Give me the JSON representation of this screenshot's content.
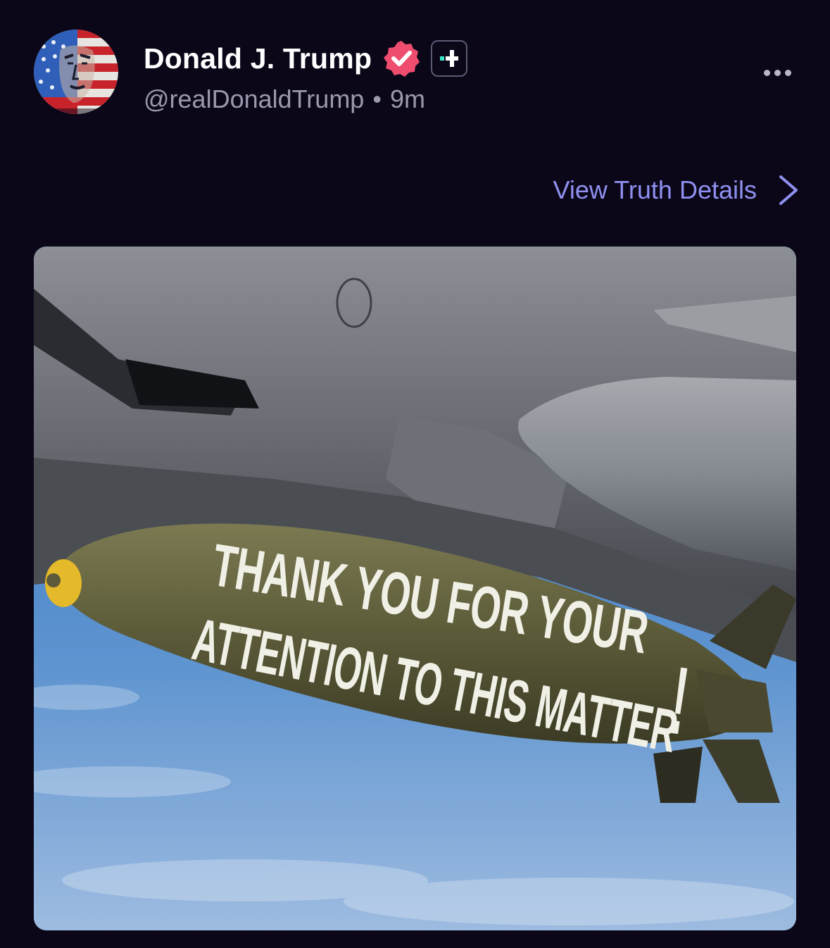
{
  "post": {
    "author": {
      "display_name": "Donald J. Trump",
      "handle": "@realDonaldTrump",
      "separator": "•",
      "timestamp": "9m",
      "avatar_icon": "flag-portrait-avatar",
      "verified_icon": "verified-badge-icon",
      "plus_icon": "truth-plus-icon"
    },
    "more_icon": "more-options-icon",
    "details_link": {
      "label": "View Truth Details",
      "icon": "chevron-right-icon"
    },
    "media": {
      "bomb_text_line1": "THANK YOU FOR YOUR",
      "bomb_text_line2": "ATTENTION TO THIS MATTER",
      "bomb_text_mark": "!"
    }
  },
  "colors": {
    "background": "#0b0719",
    "name": "#ffffff",
    "muted": "#9b99ad",
    "link": "#8f90f0",
    "verified": "#ef4d70",
    "plus_accent": "#3ce6c9"
  }
}
